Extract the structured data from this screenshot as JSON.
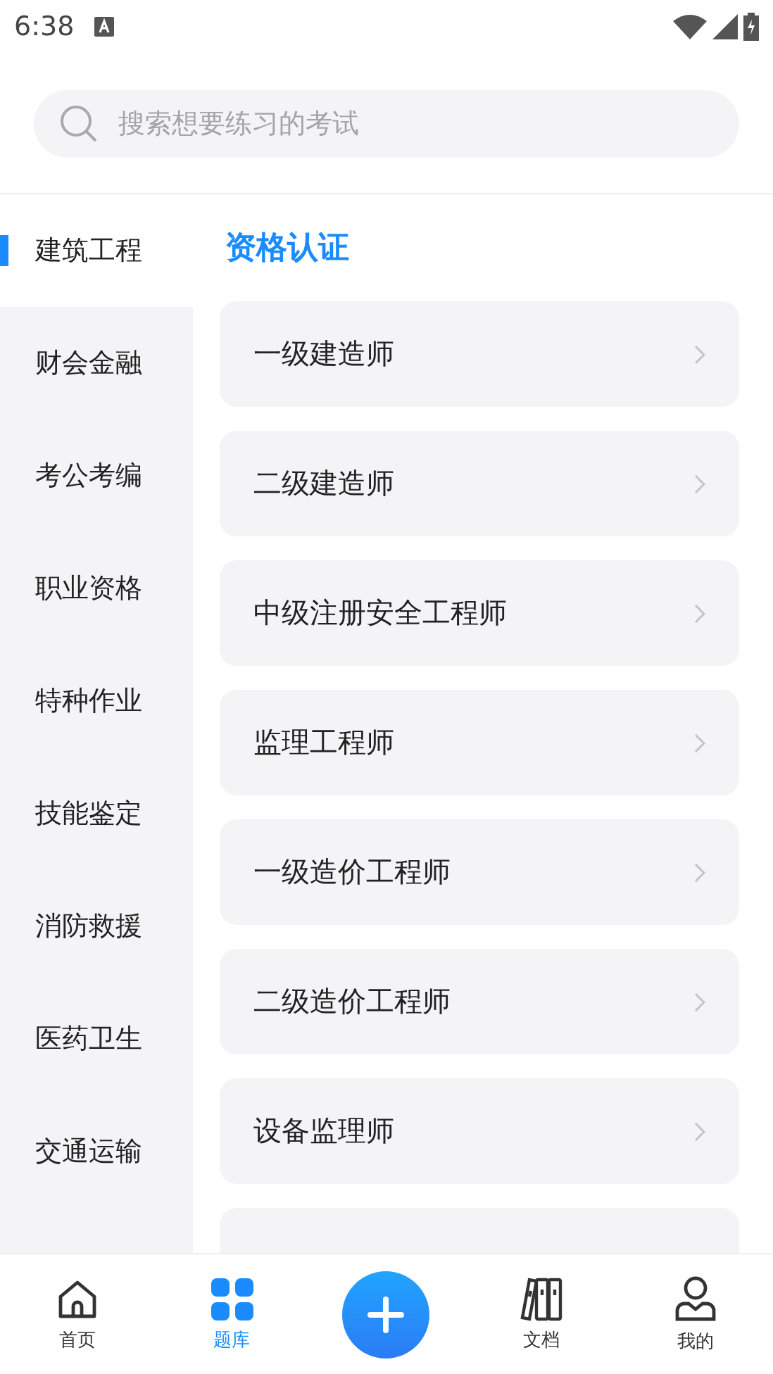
{
  "status_bar": {
    "time": "6:38"
  },
  "search": {
    "placeholder": "搜索想要练习的考试"
  },
  "sidebar": {
    "items": [
      {
        "label": "建筑工程",
        "selected": true
      },
      {
        "label": "财会金融",
        "selected": false
      },
      {
        "label": "考公考编",
        "selected": false
      },
      {
        "label": "职业资格",
        "selected": false
      },
      {
        "label": "特种作业",
        "selected": false
      },
      {
        "label": "技能鉴定",
        "selected": false
      },
      {
        "label": "消防救援",
        "selected": false
      },
      {
        "label": "医药卫生",
        "selected": false
      },
      {
        "label": "交通运输",
        "selected": false
      }
    ]
  },
  "section": {
    "title": "资格认证",
    "items": [
      "一级建造师",
      "二级建造师",
      "中级注册安全工程师",
      "监理工程师",
      "一级造价工程师",
      "二级造价工程师",
      "设备监理师"
    ],
    "cut_off_item": true
  },
  "tab_bar": {
    "items": [
      {
        "kind": "home",
        "label": "首页",
        "selected": false
      },
      {
        "kind": "grid",
        "label": "题库",
        "selected": true
      },
      {
        "kind": "add"
      },
      {
        "kind": "docs",
        "label": "文档",
        "selected": false
      },
      {
        "kind": "user",
        "label": "我的",
        "selected": false
      }
    ]
  }
}
